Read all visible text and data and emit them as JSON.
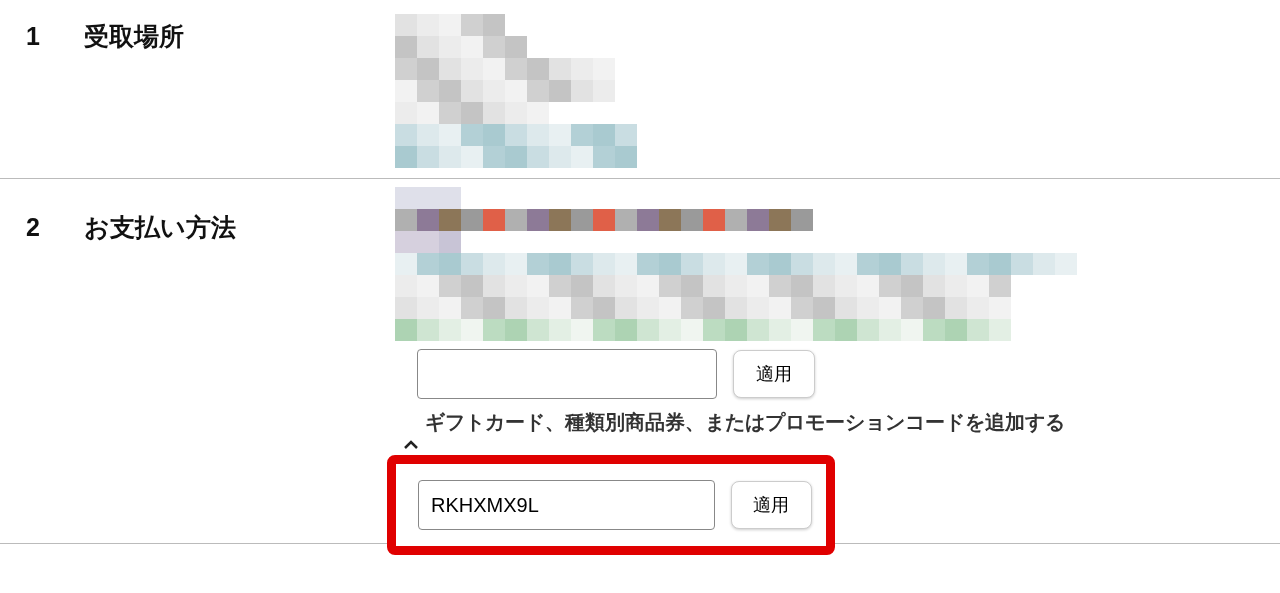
{
  "sections": [
    {
      "number": "1",
      "title": "受取場所"
    },
    {
      "number": "2",
      "title": "お支払い方法"
    }
  ],
  "payment": {
    "code_form_1": {
      "button": "適用"
    },
    "promo_toggle": {
      "label": "ギフトカード、種類別商品券、またはプロモーションコードを追加する",
      "expanded": true
    },
    "code_form_2": {
      "value": "RKHXMX9L",
      "button": "適用",
      "highlighted": true
    }
  }
}
